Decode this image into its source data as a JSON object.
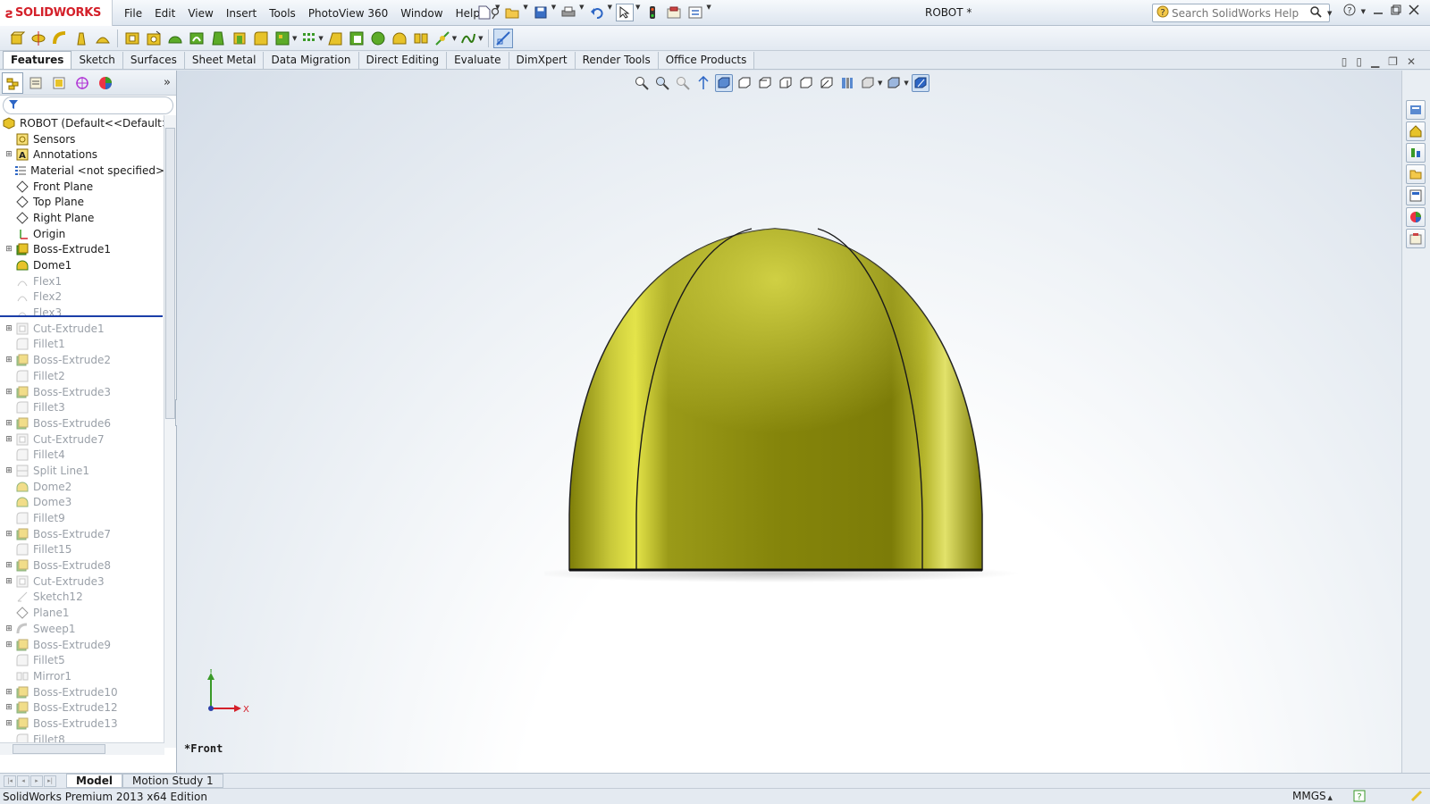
{
  "app": {
    "brand": "SOLIDWORKS",
    "document_title": "ROBOT *"
  },
  "menu": [
    "File",
    "Edit",
    "View",
    "Insert",
    "Tools",
    "PhotoView 360",
    "Window",
    "Help"
  ],
  "search": {
    "placeholder": "Search SolidWorks Help"
  },
  "tabs": [
    "Features",
    "Sketch",
    "Surfaces",
    "Sheet Metal",
    "Data Migration",
    "Direct Editing",
    "Evaluate",
    "DimXpert",
    "Render Tools",
    "Office Products"
  ],
  "feature_tree": {
    "root": "ROBOT  (Default<<Default>_D",
    "items": [
      {
        "label": "Sensors",
        "icon": "sensor-icon",
        "expandable": false,
        "suppressed": false
      },
      {
        "label": "Annotations",
        "icon": "annotations-icon",
        "expandable": true,
        "suppressed": false
      },
      {
        "label": "Material <not specified>",
        "icon": "material-icon",
        "expandable": false,
        "suppressed": false
      },
      {
        "label": "Front Plane",
        "icon": "plane-icon",
        "expandable": false,
        "suppressed": false
      },
      {
        "label": "Top Plane",
        "icon": "plane-icon",
        "expandable": false,
        "suppressed": false
      },
      {
        "label": "Right Plane",
        "icon": "plane-icon",
        "expandable": false,
        "suppressed": false
      },
      {
        "label": "Origin",
        "icon": "origin-icon",
        "expandable": false,
        "suppressed": false
      },
      {
        "label": "Boss-Extrude1",
        "icon": "extrude-icon",
        "expandable": true,
        "suppressed": false
      },
      {
        "label": "Dome1",
        "icon": "dome-icon",
        "expandable": false,
        "suppressed": false
      },
      {
        "label": "Flex1",
        "icon": "flex-icon",
        "expandable": false,
        "suppressed": true
      },
      {
        "label": "Flex2",
        "icon": "flex-icon",
        "expandable": false,
        "suppressed": true
      },
      {
        "label": "Flex3",
        "icon": "flex-icon",
        "expandable": false,
        "suppressed": true
      },
      {
        "label": "Cut-Extrude1",
        "icon": "cut-icon",
        "expandable": true,
        "suppressed": true
      },
      {
        "label": "Fillet1",
        "icon": "fillet-icon",
        "expandable": false,
        "suppressed": true
      },
      {
        "label": "Boss-Extrude2",
        "icon": "extrude-icon",
        "expandable": true,
        "suppressed": true
      },
      {
        "label": "Fillet2",
        "icon": "fillet-icon",
        "expandable": false,
        "suppressed": true
      },
      {
        "label": "Boss-Extrude3",
        "icon": "extrude-icon",
        "expandable": true,
        "suppressed": true
      },
      {
        "label": "Fillet3",
        "icon": "fillet-icon",
        "expandable": false,
        "suppressed": true
      },
      {
        "label": "Boss-Extrude6",
        "icon": "extrude-icon",
        "expandable": true,
        "suppressed": true
      },
      {
        "label": "Cut-Extrude7",
        "icon": "cut-icon",
        "expandable": true,
        "suppressed": true
      },
      {
        "label": "Fillet4",
        "icon": "fillet-icon",
        "expandable": false,
        "suppressed": true
      },
      {
        "label": "Split Line1",
        "icon": "split-line-icon",
        "expandable": true,
        "suppressed": true
      },
      {
        "label": "Dome2",
        "icon": "dome-icon",
        "expandable": false,
        "suppressed": true
      },
      {
        "label": "Dome3",
        "icon": "dome-icon",
        "expandable": false,
        "suppressed": true
      },
      {
        "label": "Fillet9",
        "icon": "fillet-icon",
        "expandable": false,
        "suppressed": true
      },
      {
        "label": "Boss-Extrude7",
        "icon": "extrude-icon",
        "expandable": true,
        "suppressed": true
      },
      {
        "label": "Fillet15",
        "icon": "fillet-icon",
        "expandable": false,
        "suppressed": true
      },
      {
        "label": "Boss-Extrude8",
        "icon": "extrude-icon",
        "expandable": true,
        "suppressed": true
      },
      {
        "label": "Cut-Extrude3",
        "icon": "cut-icon",
        "expandable": true,
        "suppressed": true
      },
      {
        "label": "Sketch12",
        "icon": "sketch-icon",
        "expandable": false,
        "suppressed": true
      },
      {
        "label": "Plane1",
        "icon": "plane-icon",
        "expandable": false,
        "suppressed": true
      },
      {
        "label": "Sweep1",
        "icon": "sweep-icon",
        "expandable": true,
        "suppressed": true
      },
      {
        "label": "Boss-Extrude9",
        "icon": "extrude-icon",
        "expandable": true,
        "suppressed": true
      },
      {
        "label": "Fillet5",
        "icon": "fillet-icon",
        "expandable": false,
        "suppressed": true
      },
      {
        "label": "Mirror1",
        "icon": "mirror-icon",
        "expandable": false,
        "suppressed": true
      },
      {
        "label": "Boss-Extrude10",
        "icon": "extrude-icon",
        "expandable": true,
        "suppressed": true
      },
      {
        "label": "Boss-Extrude12",
        "icon": "extrude-icon",
        "expandable": true,
        "suppressed": true
      },
      {
        "label": "Boss-Extrude13",
        "icon": "extrude-icon",
        "expandable": true,
        "suppressed": true
      },
      {
        "label": "Fillet8",
        "icon": "fillet-icon",
        "expandable": false,
        "suppressed": true
      }
    ]
  },
  "viewport": {
    "view_name": "*Front",
    "triad": {
      "x": "X",
      "y": "Y"
    }
  },
  "bottom_tabs": [
    "Model",
    "Motion Study 1"
  ],
  "status": {
    "edition": "SolidWorks Premium 2013 x64 Edition",
    "units": "MMGS"
  },
  "colors": {
    "model": "#8d8d10",
    "model_highlight": "#e6e64a",
    "brand": "#d4202a",
    "rollback_bar": "#1b3ea8"
  }
}
